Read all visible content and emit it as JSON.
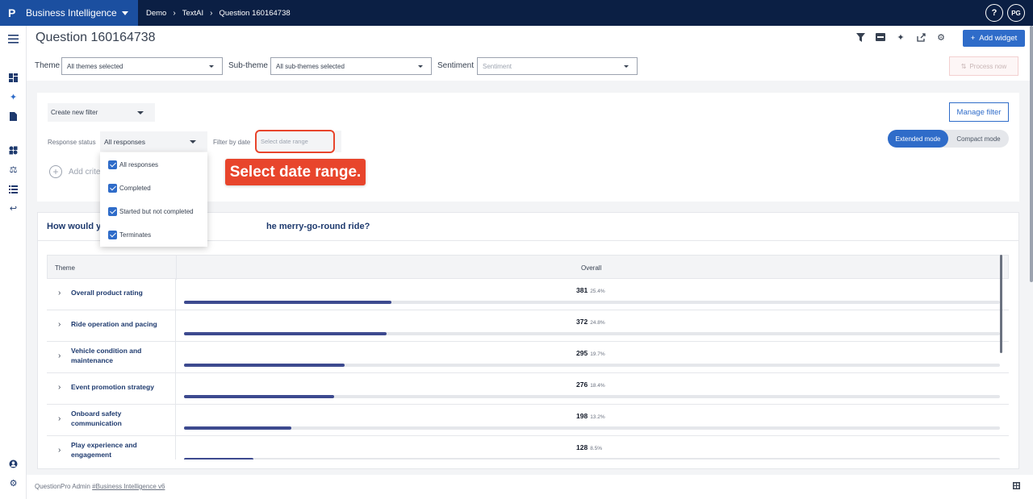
{
  "topbar": {
    "logo": "P",
    "app_name": "Business Intelligence",
    "breadcrumbs": [
      "Demo",
      "TextAI",
      "Question 160164738"
    ],
    "help_icon": "question-mark-icon",
    "user_initials": "PG"
  },
  "header": {
    "title": "Question 160164738",
    "add_widget_label": "Add widget",
    "theme_label": "Theme",
    "theme_value": "All themes selected",
    "subtheme_label": "Sub-theme",
    "subtheme_value": "All sub-themes selected",
    "sentiment_label": "Sentiment",
    "sentiment_placeholder": "Sentiment",
    "process_label": "Process now"
  },
  "filters": {
    "create_filter_label": "Create new filter",
    "manage_filter_label": "Manage filter",
    "response_status_label": "Response status",
    "response_status_value": "All responses",
    "filter_by_date_label": "Filter by date",
    "date_placeholder": "Select date range",
    "add_criteria_label": "Add crite",
    "mode_extended": "Extended mode",
    "mode_compact": "Compact mode",
    "dropdown_options": [
      "All responses",
      "Completed",
      "Started but not completed",
      "Terminates"
    ]
  },
  "callout": {
    "text": "Select date range.",
    "color": "#e8452c"
  },
  "widget": {
    "title_start": "How would yo",
    "title_end": "he merry-go-round ride?",
    "columns": [
      "Theme",
      "Overall"
    ],
    "rows": [
      {
        "label": "Overall product rating",
        "count": "381",
        "pct": "25.4%",
        "fill": 0.254
      },
      {
        "label": "Ride operation and pacing",
        "count": "372",
        "pct": "24.8%",
        "fill": 0.248
      },
      {
        "label": "Vehicle condition and maintenance",
        "count": "295",
        "pct": "19.7%",
        "fill": 0.197
      },
      {
        "label": "Event promotion strategy",
        "count": "276",
        "pct": "18.4%",
        "fill": 0.184
      },
      {
        "label": "Onboard safety communication",
        "count": "198",
        "pct": "13.2%",
        "fill": 0.132
      },
      {
        "label": "Play experience and engagement",
        "count": "128",
        "pct": "8.5%",
        "fill": 0.085
      }
    ]
  },
  "footer": {
    "prefix": "QuestionPro Admin ",
    "link": "#Business Intelligence v6"
  },
  "colors": {
    "topbar": "#0b1f44",
    "brand": "#1b4fa0",
    "accent": "#2f6cc9",
    "bar_fill": "#3d4a8f"
  }
}
